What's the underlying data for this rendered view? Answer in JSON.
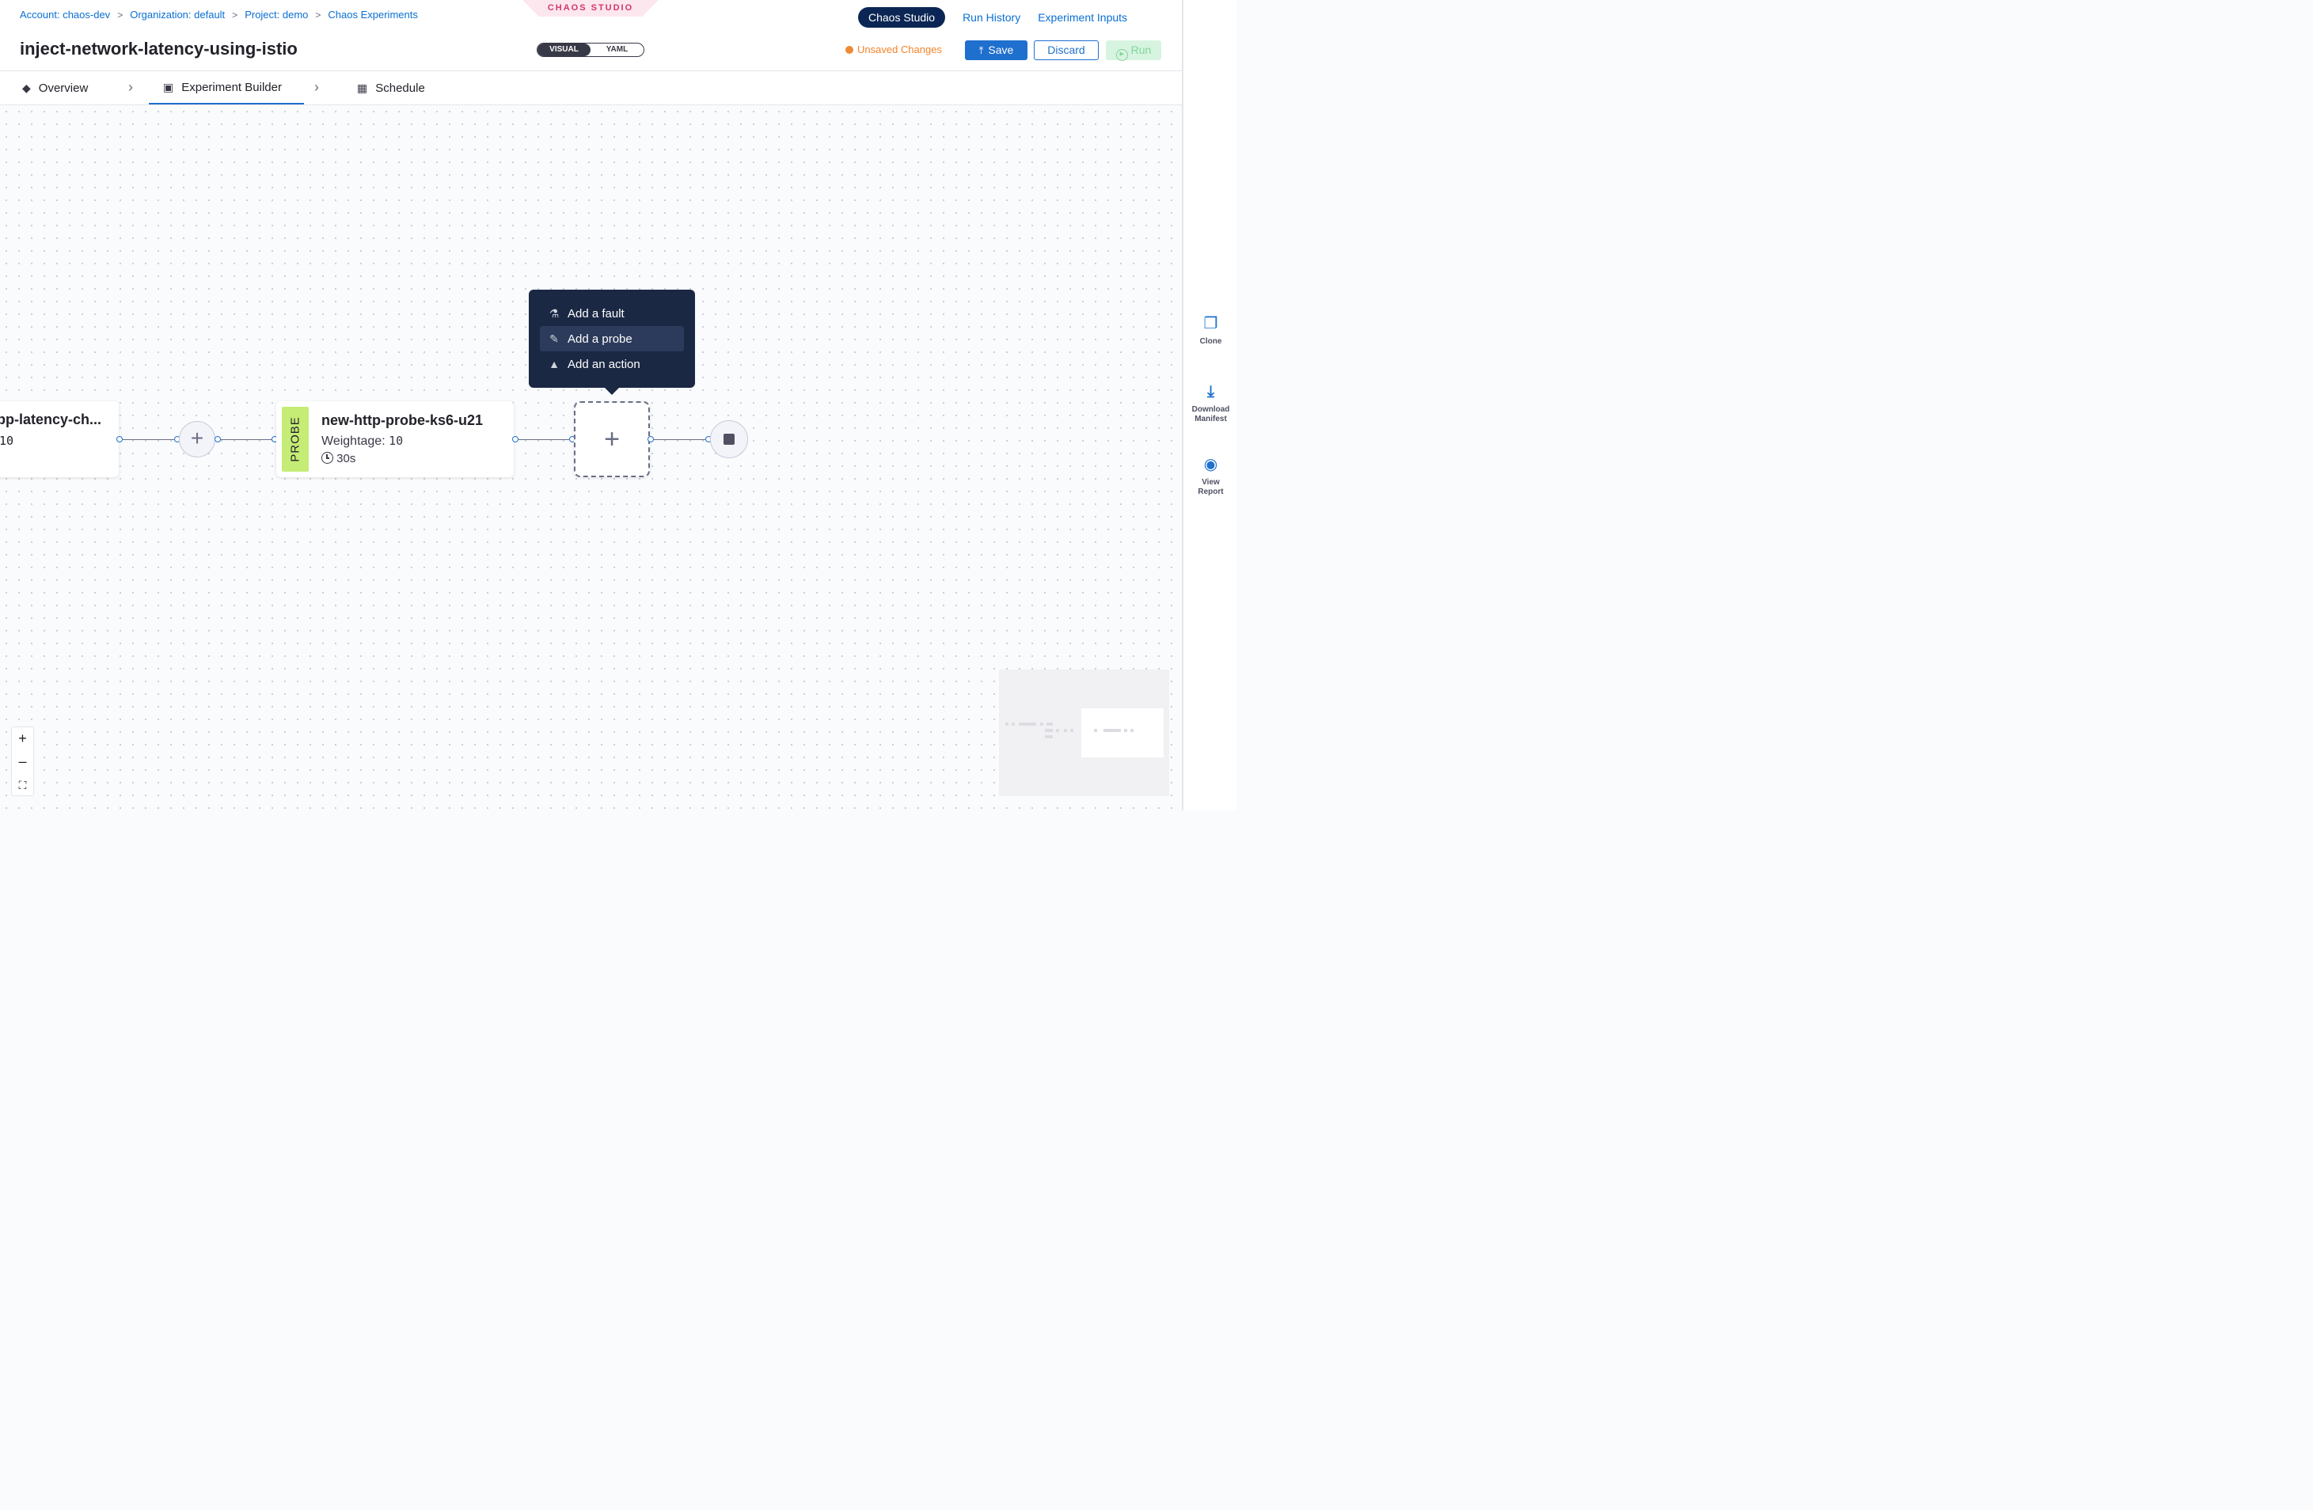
{
  "breadcrumb": {
    "account": "Account: chaos-dev",
    "org": "Organization: default",
    "project": "Project: demo",
    "section": "Chaos Experiments",
    "sep": ">"
  },
  "studio_tag": "CHAOS STUDIO",
  "title": "inject-network-latency-using-istio",
  "view_toggle": {
    "visual": "VISUAL",
    "yaml": "YAML"
  },
  "topnav": {
    "studio": "Chaos Studio",
    "history": "Run History",
    "inputs": "Experiment Inputs"
  },
  "status": {
    "unsaved": "Unsaved Changes"
  },
  "actions": {
    "save": "Save",
    "discard": "Discard",
    "run": "Run"
  },
  "tabs": [
    {
      "label": "Overview",
      "icon": "overview-icon"
    },
    {
      "label": "Experiment Builder",
      "icon": "builder-icon"
    },
    {
      "label": "Schedule",
      "icon": "calendar-icon"
    }
  ],
  "graph": {
    "left_node": {
      "title": "pp-latency-ch...",
      "value": "10"
    },
    "probe_node": {
      "tag": "PROBE",
      "title": "new-http-probe-ks6-u21",
      "weight_label": "Weightage:",
      "weight_value": "10",
      "timeout": "30s"
    }
  },
  "add_menu": {
    "items": [
      {
        "label": "Add a fault",
        "icon": "flask-icon"
      },
      {
        "label": "Add a probe",
        "icon": "probe-icon"
      },
      {
        "label": "Add an action",
        "icon": "bell-icon"
      }
    ]
  },
  "rail": {
    "clone": "Clone",
    "download": "Download Manifest",
    "report": "View Report"
  },
  "zoom": {
    "in": "+",
    "out": "–"
  },
  "colors": {
    "primary": "#1f6fce",
    "navy": "#0b2654",
    "warning": "#f3842b",
    "probe": "#c5ec75",
    "menu": "#1b2844"
  }
}
